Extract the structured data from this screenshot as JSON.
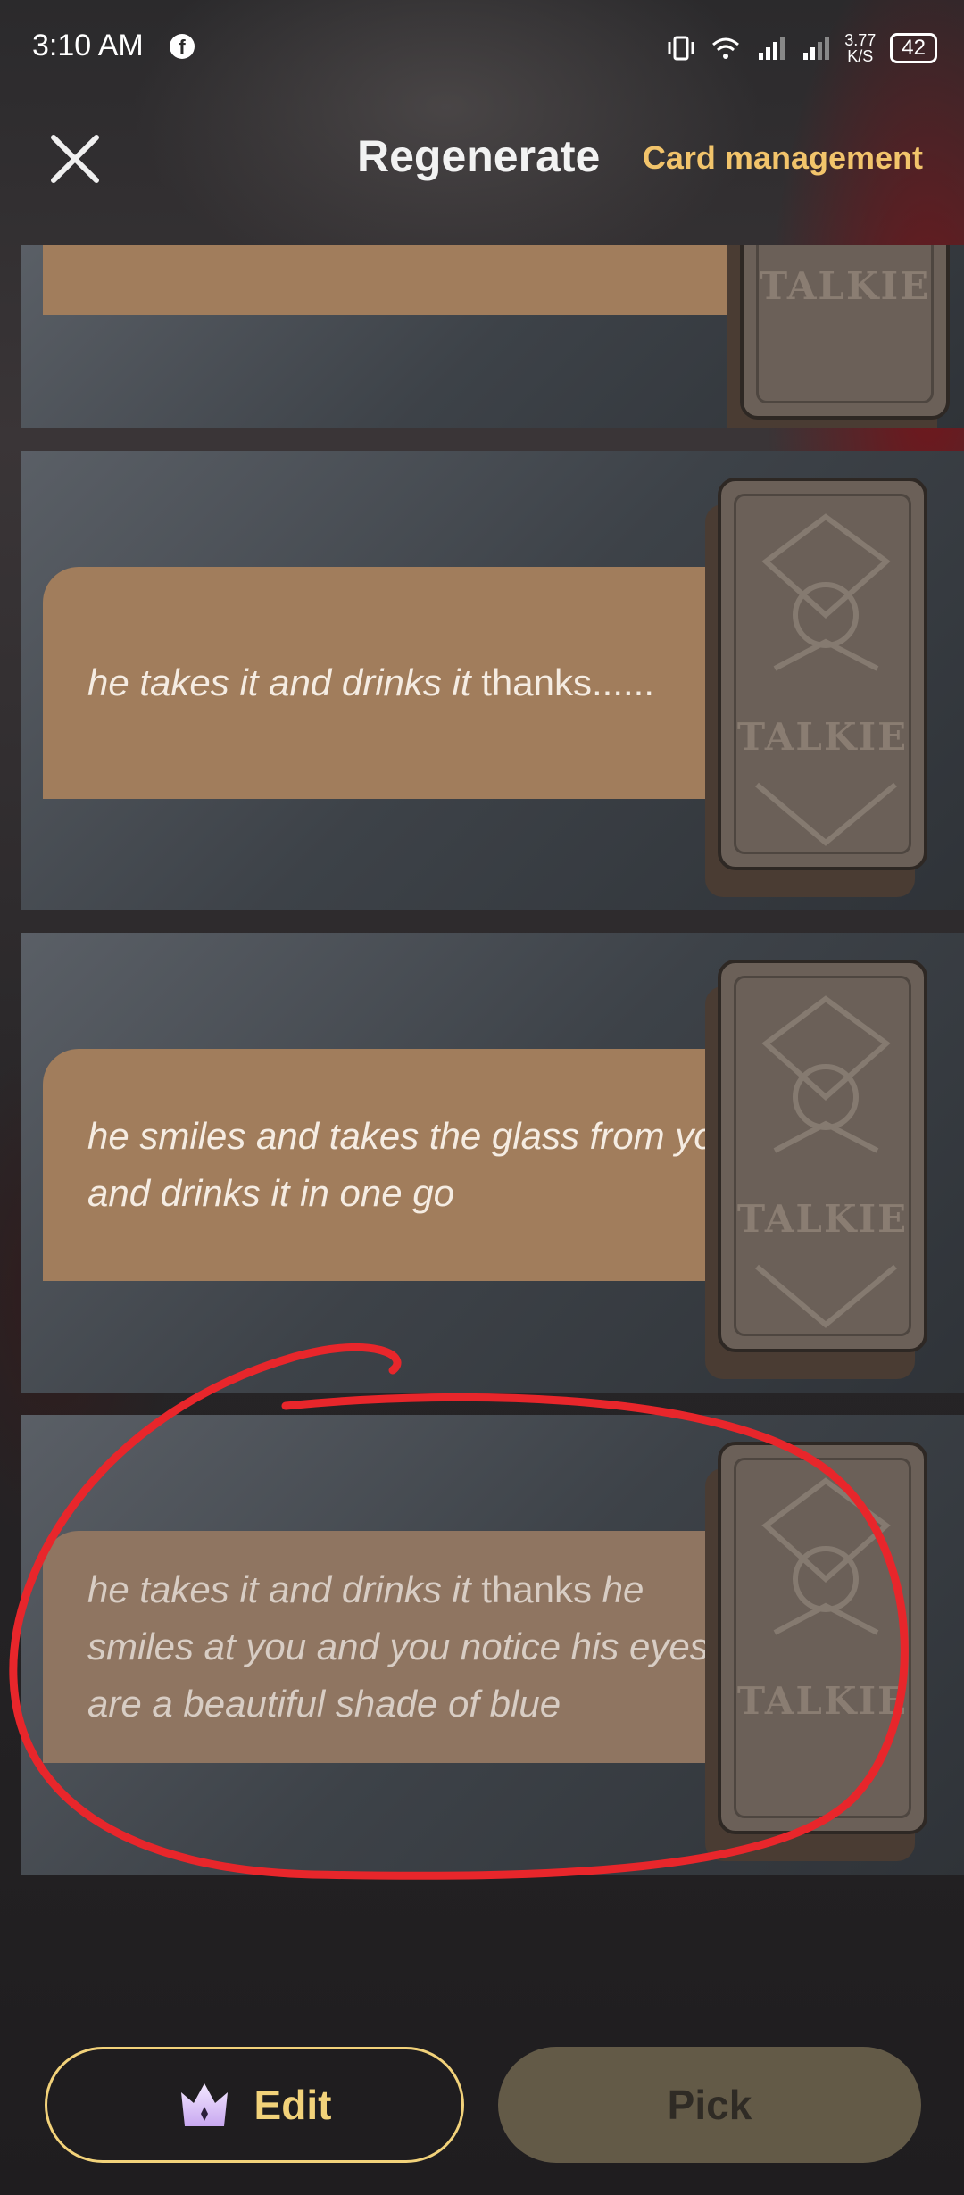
{
  "status_bar": {
    "time": "3:10 AM",
    "app_icon": "facebook-icon",
    "net_speed_value": "3.77",
    "net_speed_unit": "K/S",
    "battery": "42"
  },
  "header": {
    "title": "Regenerate",
    "card_management": "Card management",
    "close_icon": "close-icon"
  },
  "options": [
    {
      "italic": "",
      "plain": ""
    },
    {
      "italic": "he takes it and drinks it",
      "plain": " thanks......",
      "italic_after": ""
    },
    {
      "italic": "he smiles and takes the glass from you and drinks it in one go",
      "plain": "",
      "italic_after": ""
    },
    {
      "italic": "he takes it and drinks it",
      "plain": " thanks ",
      "italic_after": "he smiles at you and you notice his eyes are a beautiful shade of blue"
    }
  ],
  "card_logo": "TALKIE",
  "footer": {
    "edit_label": "Edit",
    "pick_label": "Pick",
    "edit_icon": "crown-icon"
  },
  "colors": {
    "accent": "#f2c46b",
    "bubble": "#a17d5c",
    "annotation": "#e8262b"
  }
}
